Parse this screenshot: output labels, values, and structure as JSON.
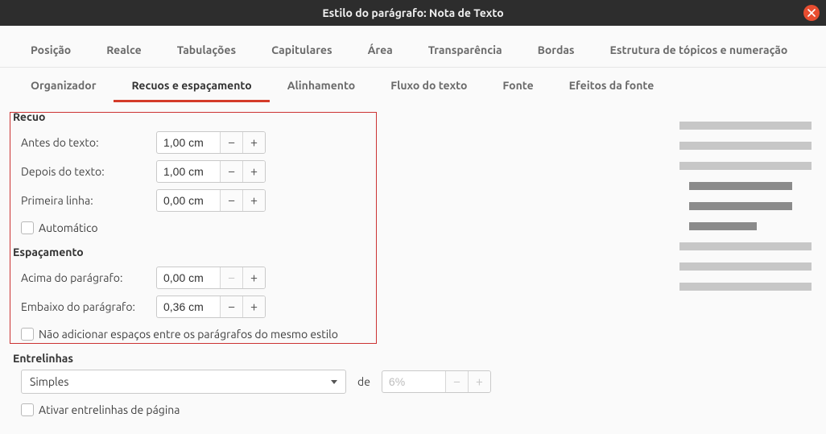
{
  "window": {
    "title": "Estilo do parágrafo: Nota de Texto"
  },
  "tabs_top": {
    "items": [
      {
        "label": "Posição"
      },
      {
        "label": "Realce"
      },
      {
        "label": "Tabulações"
      },
      {
        "label": "Capitulares"
      },
      {
        "label": "Área"
      },
      {
        "label": "Transparência"
      },
      {
        "label": "Bordas"
      },
      {
        "label": "Estrutura de tópicos e numeração"
      }
    ]
  },
  "tabs_sub": {
    "items": [
      {
        "label": "Organizador",
        "active": false
      },
      {
        "label": "Recuos e espaçamento",
        "active": true
      },
      {
        "label": "Alinhamento",
        "active": false
      },
      {
        "label": "Fluxo do texto",
        "active": false
      },
      {
        "label": "Fonte",
        "active": false
      },
      {
        "label": "Efeitos da fonte",
        "active": false
      }
    ]
  },
  "sections": {
    "indent": {
      "title": "Recuo",
      "before_text_label": "Antes do texto:",
      "before_text_value": "1,00 cm",
      "after_text_label": "Depois do texto:",
      "after_text_value": "1,00 cm",
      "first_line_label": "Primeira linha:",
      "first_line_value": "0,00 cm",
      "automatic_label": "Automático"
    },
    "spacing": {
      "title": "Espaçamento",
      "above_label": "Acima do parágrafo:",
      "above_value": "0,00 cm",
      "below_label": "Embaixo do parágrafo:",
      "below_value": "0,36 cm",
      "no_add_space_label": "Não adicionar espaços entre os parágrafos do mesmo estilo"
    },
    "linespacing": {
      "title": "Entrelinhas",
      "selected": "Simples",
      "de_label": "de",
      "percent_value": "6%",
      "activate_page_label": "Ativar entrelinhas de página"
    }
  },
  "icons": {
    "minus": "−",
    "plus": "+"
  }
}
